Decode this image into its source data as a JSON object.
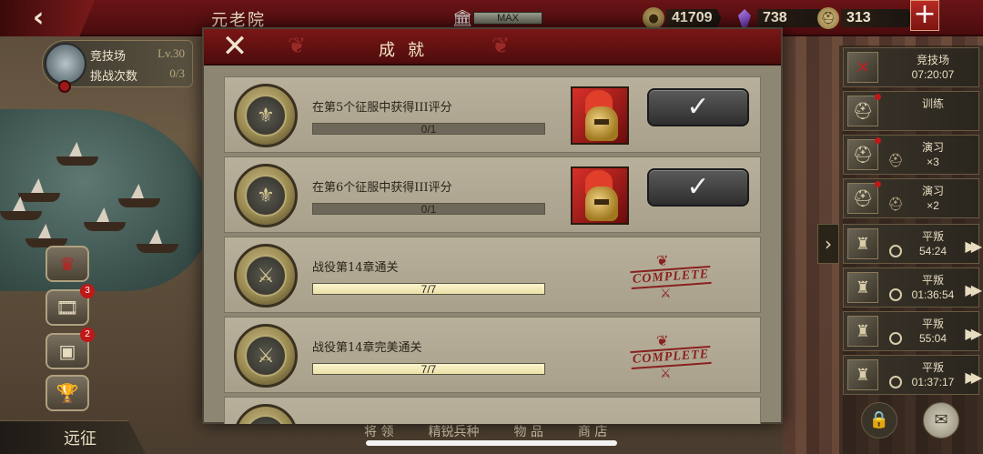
{
  "topbar": {
    "title": "元老院",
    "max_label": "MAX",
    "coins": "41709",
    "gems": "738",
    "helmets": "313",
    "plus": "+"
  },
  "left": {
    "arena_label": "竞技场",
    "arena_level": "Lv.30",
    "challenge_label": "挑战次数",
    "challenge_count": "0/3",
    "badges": [
      "3",
      "2"
    ],
    "expedition": "远征"
  },
  "bottom_tabs": [
    "将 领",
    "精锐兵种",
    "物 品",
    "商 店"
  ],
  "modal": {
    "title": "成就",
    "rows": [
      {
        "title": "在第5个征服中获得III评分",
        "progress_text": "0/1",
        "progress": 0,
        "state": "claim"
      },
      {
        "title": "在第6个征服中获得III评分",
        "progress_text": "0/1",
        "progress": 0,
        "state": "claim"
      },
      {
        "title": "战役第14章通关",
        "progress_text": "7/7",
        "progress": 1,
        "state": "complete"
      },
      {
        "title": "战役第14章完美通关",
        "progress_text": "7/7",
        "progress": 1,
        "state": "complete"
      }
    ],
    "complete_label": "COMPLETE"
  },
  "right_list": [
    {
      "title": "竞技场",
      "sub": "07:20:07",
      "icon": "crossed-swords-icon"
    },
    {
      "title": "训练",
      "sub": "",
      "icon": "helmet-icon"
    },
    {
      "title": "演习",
      "sub": "×3",
      "icon": "helmet-icon"
    },
    {
      "title": "演习",
      "sub": "×2",
      "icon": "helmet-icon"
    },
    {
      "title": "平叛",
      "sub": "54:24",
      "icon": "warrior-icon"
    },
    {
      "title": "平叛",
      "sub": "01:36:54",
      "icon": "warrior-icon"
    },
    {
      "title": "平叛",
      "sub": "55:04",
      "icon": "warrior-icon"
    },
    {
      "title": "平叛",
      "sub": "01:37:17",
      "icon": "warrior-icon"
    }
  ],
  "colors": {
    "header_red": "#6a1416",
    "panel_bg": "#8c8672",
    "progress_fill": "#f8f0c8",
    "stamp_red": "#8a2020"
  }
}
